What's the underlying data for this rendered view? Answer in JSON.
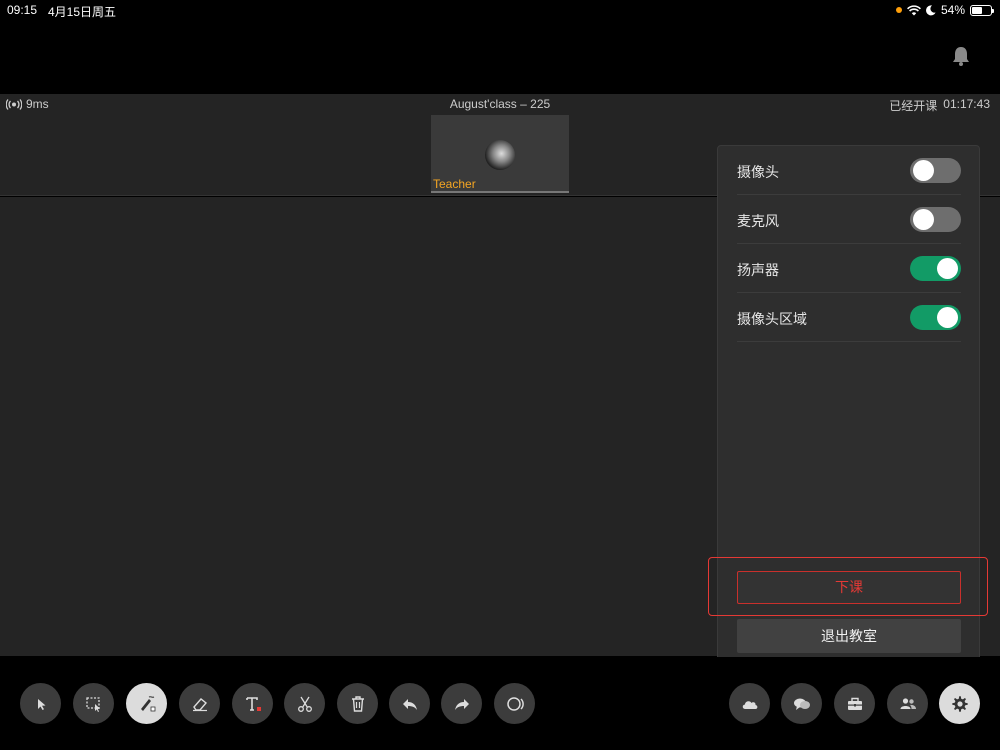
{
  "status_bar": {
    "time": "09:15",
    "date": "4月15日周五",
    "battery": "54%"
  },
  "class_bar": {
    "latency": "9ms",
    "title": "August'class – 225",
    "elapsed_label": "已经开课",
    "elapsed_time": "01:17:43"
  },
  "video": {
    "name": "Teacher"
  },
  "settings": {
    "items": [
      {
        "label": "摄像头",
        "on": false
      },
      {
        "label": "麦克风",
        "on": false
      },
      {
        "label": "扬声器",
        "on": true
      },
      {
        "label": "摄像头区域",
        "on": true
      }
    ],
    "end_class": "下课",
    "leave_room": "退出教室"
  },
  "colors": {
    "accent_green": "#129b66",
    "danger_red": "#e53935",
    "teacher_label": "#f5a623"
  },
  "toolbar": {
    "left_tools": [
      "select-icon",
      "marquee-select-icon",
      "pen-icon",
      "eraser-icon",
      "text-icon",
      "scissors-icon",
      "trash-icon",
      "undo-icon",
      "redo-icon",
      "laser-icon"
    ],
    "right_tools": [
      "cloud-icon",
      "chat-icon",
      "toolbox-icon",
      "users-icon",
      "settings-gear-icon"
    ]
  }
}
